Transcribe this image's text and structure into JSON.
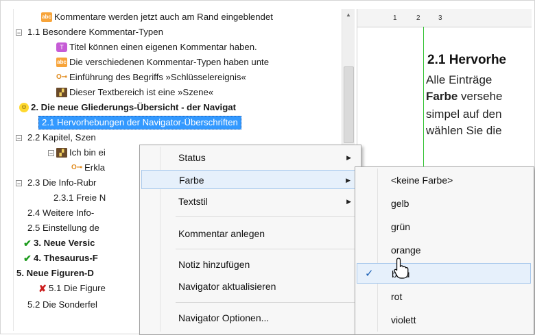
{
  "tree": {
    "rows": [
      {
        "label": "Kommentare werden jetzt auch am Rand eingeblendet",
        "icon": "abc-icon"
      },
      {
        "label": "1.1 Besondere Kommentar-Typen",
        "icon": ""
      },
      {
        "label": "Titel können einen eigenen Kommentar haben.",
        "icon": "speech-icon"
      },
      {
        "label": "Die verschiedenen Kommentar-Typen haben unte",
        "icon": "abc-icon"
      },
      {
        "label": "Einführung des Begriffs »Schlüsselereignis«",
        "icon": "key-icon"
      },
      {
        "label": "Dieser Textbereich ist eine »Szene«",
        "icon": "clapper-icon"
      },
      {
        "label": "2. Die neue Gliederungs-Übersicht - der Navigat",
        "icon": "smiley-icon"
      },
      {
        "label": "2.1 Hervorhebungen der Navigator-Überschriften",
        "icon": ""
      },
      {
        "label": "2.2 Kapitel, Szen",
        "icon": ""
      },
      {
        "label": "Ich bin ei",
        "icon": "clapper-icon"
      },
      {
        "label": "Erkla",
        "icon": "key-icon"
      },
      {
        "label": "2.3 Die Info-Rubr",
        "icon": ""
      },
      {
        "label": "2.3.1 Freie N",
        "icon": ""
      },
      {
        "label": "2.4 Weitere Info-",
        "icon": ""
      },
      {
        "label": "2.5 Einstellung de",
        "icon": ""
      },
      {
        "label": "3. Neue Versic",
        "icon": "check-icon"
      },
      {
        "label": "4. Thesaurus-F",
        "icon": "check-icon"
      },
      {
        "label": "5. Neue Figuren-D",
        "icon": ""
      },
      {
        "label": "5.1 Die Figure",
        "icon": "x-icon"
      },
      {
        "label": "5.2 Die Sonderfel",
        "icon": ""
      }
    ]
  },
  "document": {
    "ruler": [
      "1",
      "2",
      "3"
    ],
    "heading": "2.1 Hervorhe",
    "line1": "Alle Einträge",
    "line2_bold": "Farbe",
    "line2_rest": " versehe",
    "line3": "simpel auf den",
    "line4": "wählen Sie die"
  },
  "context_menu": {
    "items": [
      {
        "label": "Status",
        "submenu": true
      },
      {
        "label": "Farbe",
        "submenu": true
      },
      {
        "label": "Textstil",
        "submenu": true
      },
      {
        "label": "Kommentar anlegen",
        "submenu": false
      },
      {
        "label": "Notiz hinzufügen",
        "submenu": false
      },
      {
        "label": "Navigator aktualisieren",
        "submenu": false
      },
      {
        "label": "Navigator Optionen...",
        "submenu": false
      }
    ]
  },
  "color_submenu": {
    "items": [
      "<keine Farbe>",
      "gelb",
      "grün",
      "orange",
      "blau",
      "rot",
      "violett"
    ],
    "checked": "blau"
  },
  "colors": {
    "selection": "#3399ff",
    "menu_highlight": "#e6f0fb",
    "ruler_green": "#3ac43a"
  }
}
